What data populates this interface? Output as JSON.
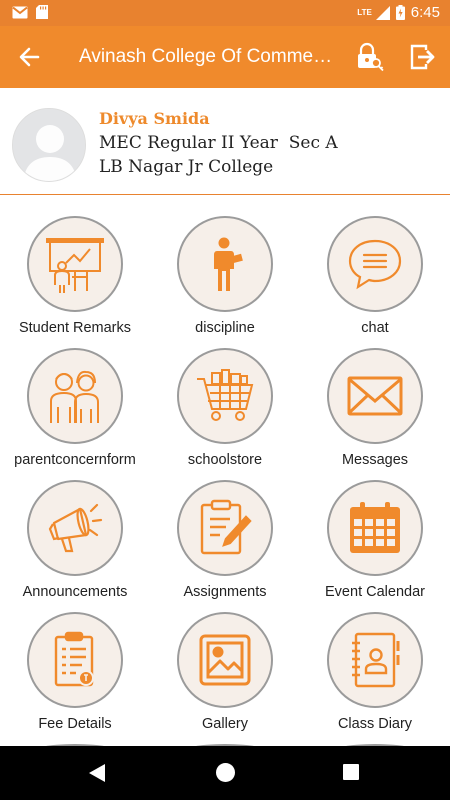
{
  "status_bar": {
    "time": "6:45",
    "network": "LTE",
    "battery_icon": "battery-charging-icon"
  },
  "app_bar": {
    "title": "Avinash College Of Commerce",
    "accent": "#f08a2c"
  },
  "profile": {
    "name": "Divya Smida",
    "class_info": "MEC Regular II Year  Sec A",
    "college": "LB Nagar Jr College"
  },
  "menu": [
    {
      "label": "Student Remarks",
      "icon": "teacher-board-icon"
    },
    {
      "label": "discipline",
      "icon": "standing-student-icon"
    },
    {
      "label": "chat",
      "icon": "chat-bubble-icon"
    },
    {
      "label": "parentconcernform",
      "icon": "parents-icon"
    },
    {
      "label": "schoolstore",
      "icon": "shopping-cart-icon"
    },
    {
      "label": "Messages",
      "icon": "envelope-icon"
    },
    {
      "label": "Announcements",
      "icon": "megaphone-icon"
    },
    {
      "label": "Assignments",
      "icon": "clipboard-pencil-icon"
    },
    {
      "label": "Event Calendar",
      "icon": "calendar-icon"
    },
    {
      "label": "Fee Details",
      "icon": "fee-invoice-icon"
    },
    {
      "label": "Gallery",
      "icon": "picture-icon"
    },
    {
      "label": "Class Diary",
      "icon": "diary-book-icon"
    }
  ]
}
